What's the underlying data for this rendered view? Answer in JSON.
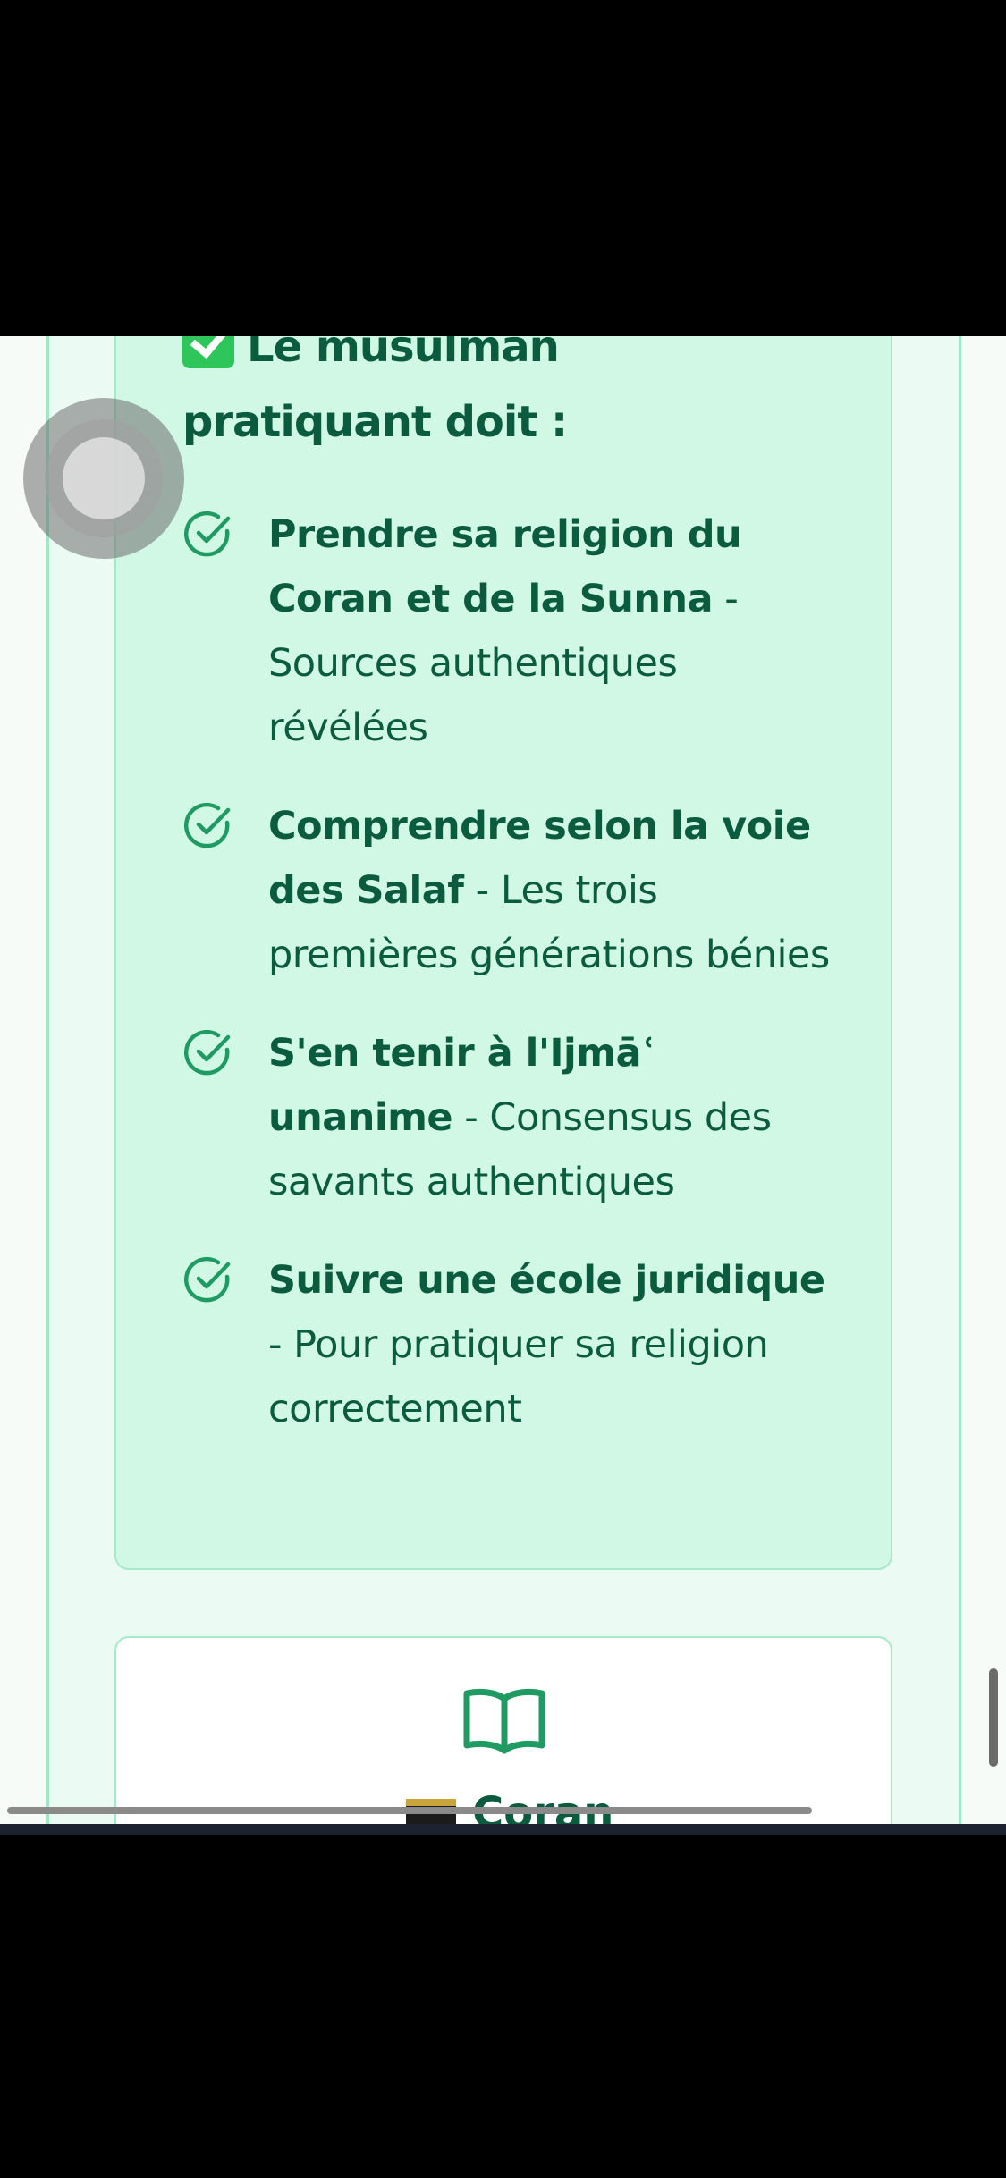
{
  "card": {
    "heading_line1": "Le musulman",
    "heading_line2": "pratiquant doit :"
  },
  "items": [
    {
      "bold": "Prendre sa religion du Coran et de la Sunna",
      "rest": " - Sources authentiques révélées"
    },
    {
      "bold": "Comprendre selon la voie des Salaf",
      "rest": " - Les trois premières générations bénies"
    },
    {
      "bold": "S'en tenir à l'Ijmāʿ unanime",
      "rest": " - Consensus des savants authentiques"
    },
    {
      "bold": "Suivre une école juridique",
      "rest": " - Pour pratiquer sa religion correctement"
    }
  ],
  "next_card": {
    "title": "Coran",
    "icon": "book-open-icon"
  },
  "colors": {
    "accent": "#0b5c3f",
    "card_bg": "#d1f7e5",
    "border": "#a6e9c9",
    "check": "#2ec55b"
  }
}
